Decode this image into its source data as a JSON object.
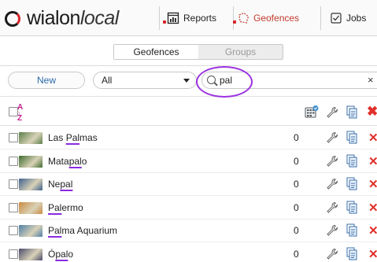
{
  "header": {
    "logo_text_main": "wialon",
    "logo_text_sub": "local",
    "nav": [
      {
        "label": "Reports",
        "icon": "reports-icon"
      },
      {
        "label": "Geofences",
        "icon": "geofences-icon"
      },
      {
        "label": "Jobs",
        "icon": "jobs-icon"
      }
    ]
  },
  "tabs": [
    {
      "label": "Geofences",
      "active": true
    },
    {
      "label": "Groups",
      "active": false
    }
  ],
  "filter": {
    "new_label": "New",
    "select_value": "All",
    "search_value": "pal",
    "clear_label": "×"
  },
  "list_header": {
    "sort_label_top": "A",
    "sort_label_bottom": "Z"
  },
  "rows": [
    {
      "pre": "Las ",
      "match": "Pal",
      "post": "mas",
      "count": "0",
      "thumb_color": "#5a7f4a"
    },
    {
      "pre": "Mata",
      "match": "pal",
      "post": "o",
      "count": "0",
      "thumb_color": "#3d6b2c"
    },
    {
      "pre": "Ne",
      "match": "pal",
      "post": "",
      "count": "0",
      "thumb_color": "#3e5f8c"
    },
    {
      "pre": "",
      "match": "Pal",
      "post": "ermo",
      "count": "0",
      "thumb_color": "#c98a3e"
    },
    {
      "pre": "",
      "match": "Pal",
      "post": "ma Aquarium",
      "count": "0",
      "thumb_color": "#4d7fa6"
    },
    {
      "pre": "Ó",
      "match": "pal",
      "post": "o",
      "count": "0",
      "thumb_color": "#4a4a6a"
    }
  ],
  "colors": {
    "accent_red": "#e0302a",
    "highlight_purple": "#9b32e0",
    "link_blue": "#2a6aa8"
  }
}
